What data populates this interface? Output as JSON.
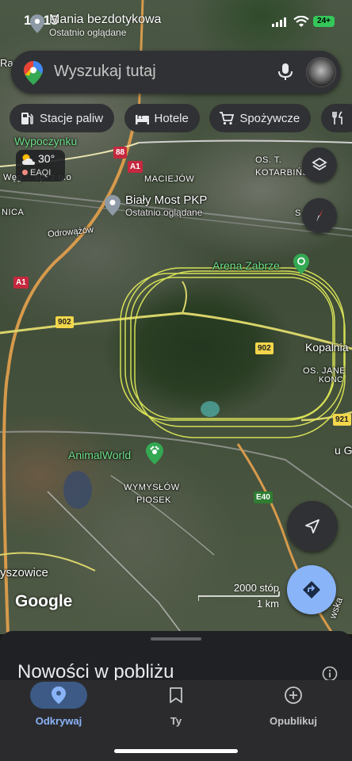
{
  "status_bar": {
    "time": "16:15",
    "battery": "24+"
  },
  "recent_top": {
    "title": "Mania bezdotykowa",
    "subtitle": "Ostatnio oglądane"
  },
  "search": {
    "placeholder": "Wyszukaj tutaj"
  },
  "chips": [
    {
      "label": "Stacje paliw",
      "icon": "gas-station-icon"
    },
    {
      "label": "Hotele",
      "icon": "bed-icon"
    },
    {
      "label": "Spożywcze",
      "icon": "cart-icon"
    }
  ],
  "weather": {
    "temperature": "30°",
    "aqi_label": "EAQI"
  },
  "map": {
    "labels": {
      "wypoczynku": "Wypoczynku",
      "company": "Węg... Sp. z o.o",
      "maciejow": "MACIEJÓW",
      "os_kotarbinski": "OS. T.\nKOTARBIŃSKI",
      "nica": "NICA",
      "ra": "Ra",
      "odrowazow": "Odrowążów",
      "kopalnia": "Kopalnia",
      "os_jane": "OS. JANE",
      "u_g": "u G",
      "wymyslow": "WYMYSŁÓW",
      "piosek": "PIOSEK",
      "rzyszowice": "yszowice",
      "konc": "KONC",
      "wska": "wska",
      "s_zab": "S Zab"
    },
    "pois": [
      {
        "name": "Biały Most PKP",
        "subtitle": "Ostatnio oglądane"
      },
      {
        "name": "Arena Zabrze"
      },
      {
        "name": "AnimalWorld"
      }
    ],
    "road_shields": {
      "r88": "88",
      "a1_top": "A1",
      "a1_left": "A1",
      "r902_left": "902",
      "r902_right": "902",
      "r921": "921",
      "e40": "E40"
    },
    "attribution": "Google",
    "scale": {
      "imperial": "2000 stóp",
      "metric": "1 km"
    }
  },
  "sheet": {
    "title": "Nowości w pobliżu"
  },
  "nav": [
    {
      "label": "Odkrywaj",
      "icon": "explore-pin-icon",
      "active": true
    },
    {
      "label": "Ty",
      "icon": "bookmark-icon",
      "active": false
    },
    {
      "label": "Opublikuj",
      "icon": "add-circle-icon",
      "active": false
    }
  ],
  "colors": {
    "accent": "#8ab4f8",
    "surface": "#303134",
    "flight_path": "#e6f05a",
    "poi_green": "#6ee28a"
  }
}
